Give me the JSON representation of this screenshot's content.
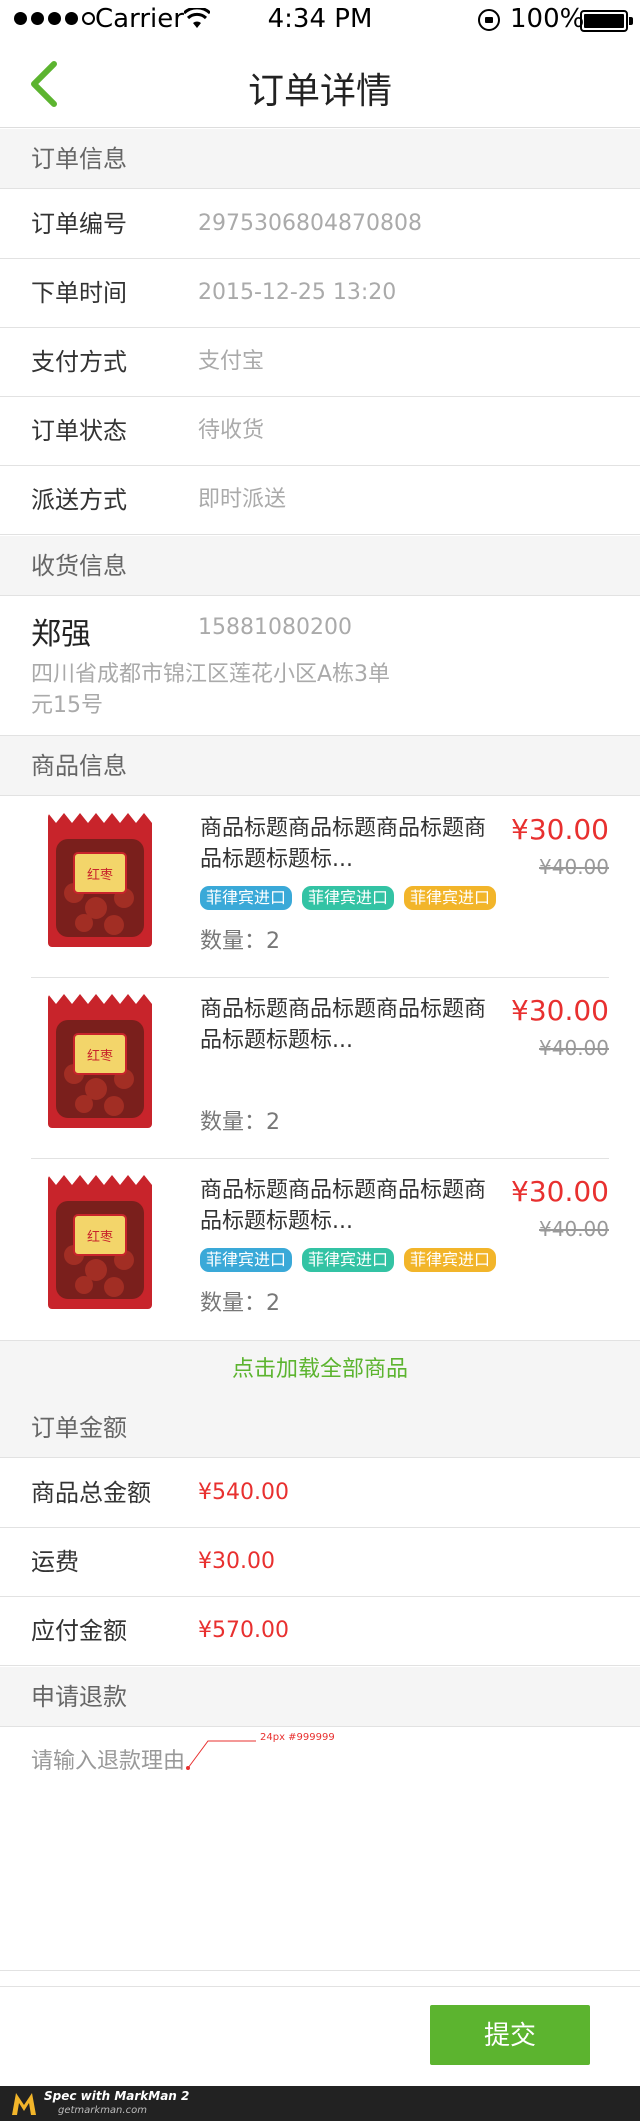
{
  "status_bar": {
    "carrier": "Carrier",
    "time": "4:34 PM",
    "battery": "100%"
  },
  "nav": {
    "title": "订单详情"
  },
  "order_info": {
    "header": "订单信息",
    "rows": [
      {
        "label": "订单编号",
        "value": "2975306804870808"
      },
      {
        "label": "下单时间",
        "value": "2015-12-25 13:20"
      },
      {
        "label": "支付方式",
        "value": "支付宝"
      },
      {
        "label": "订单状态",
        "value": "待收货"
      },
      {
        "label": "派送方式",
        "value": "即时派送"
      }
    ]
  },
  "consignee": {
    "header": "收货信息",
    "name": "郑强",
    "phone": "15881080200",
    "address": "四川省成都市锦江区莲花小区A栋3单元15号"
  },
  "products": {
    "header": "商品信息",
    "items": [
      {
        "title": "商品标题商品标题商品标题商品标题标题标...",
        "price": "¥30.00",
        "old_price": "¥40.00",
        "tags": [
          "菲律宾进口",
          "菲律宾进口",
          "菲律宾进口"
        ],
        "qty": "数量：2",
        "image_label": "红枣"
      },
      {
        "title": "商品标题商品标题商品标题商品标题标题标...",
        "price": "¥30.00",
        "old_price": "¥40.00",
        "tags": [],
        "qty": "数量：2",
        "image_label": "红枣"
      },
      {
        "title": "商品标题商品标题商品标题商品标题标题标...",
        "price": "¥30.00",
        "old_price": "¥40.00",
        "tags": [
          "菲律宾进口",
          "菲律宾进口",
          "菲律宾进口"
        ],
        "qty": "数量：2",
        "image_label": "红枣"
      }
    ],
    "load_more": "点击加载全部商品"
  },
  "amount": {
    "header": "订单金额",
    "rows": [
      {
        "label": "商品总金额",
        "value": "¥540.00"
      },
      {
        "label": "运费",
        "value": "¥30.00"
      },
      {
        "label": "应付金额",
        "value": "¥570.00"
      }
    ]
  },
  "refund": {
    "header": "申请退款",
    "placeholder": "请输入退款理由",
    "annotation": "24px #999999"
  },
  "submit_label": "提交",
  "footer": {
    "brand": "Spec with MarkMan 2",
    "url": "getmarkman.com"
  },
  "colors": {
    "accent": "#5cb42f",
    "price": "#e8302f",
    "tag_blue": "#3aa9d8",
    "tag_green": "#33c3a4",
    "tag_orange": "#f2b52a"
  }
}
